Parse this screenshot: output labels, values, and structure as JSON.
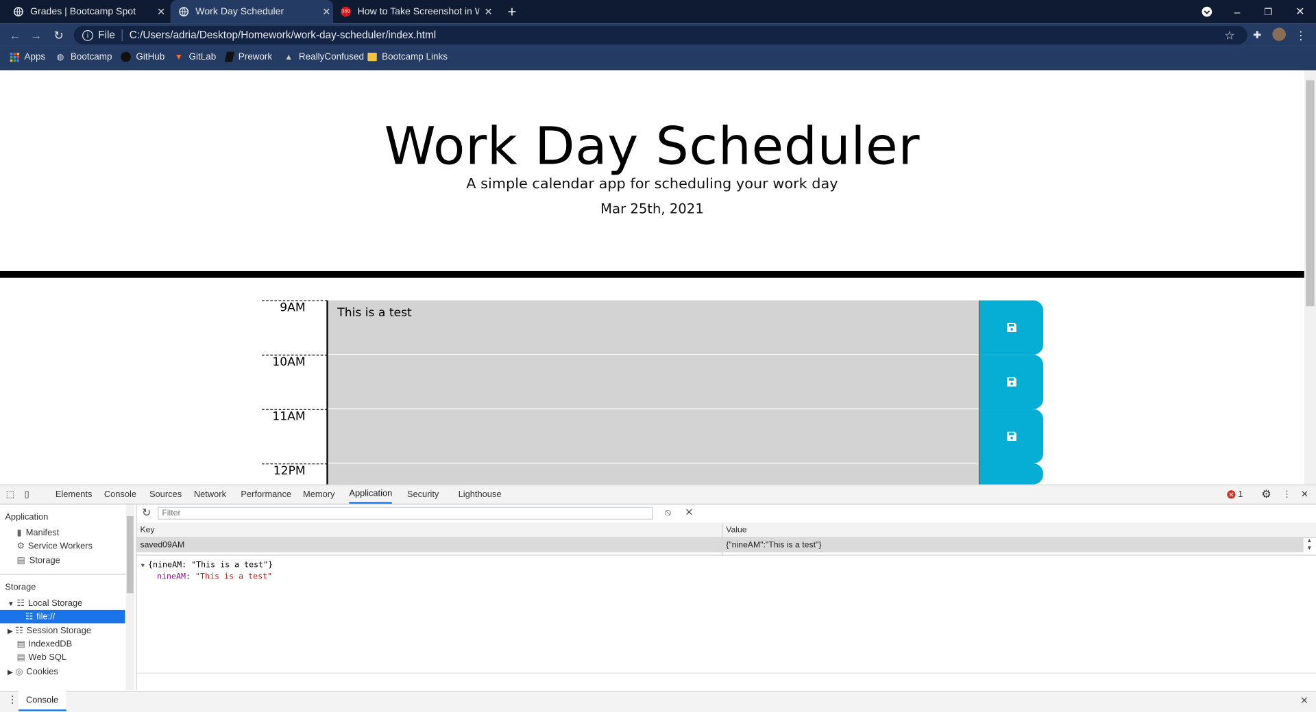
{
  "browser": {
    "tabs": [
      {
        "title": "Grades | Bootcamp Spot",
        "icon": "globe-icon"
      },
      {
        "title": "Work Day Scheduler",
        "icon": "globe-icon"
      },
      {
        "title": "How to Take Screenshot in Windows",
        "icon": "360-icon"
      }
    ],
    "url_scheme": "File",
    "url": "C:/Users/adria/Desktop/Homework/work-day-scheduler/index.html",
    "bookmarks": [
      {
        "label": "Apps",
        "icon": "apps-grid-icon"
      },
      {
        "label": "Bootcamp",
        "icon": "globe-icon"
      },
      {
        "label": "GitHub",
        "icon": "github-icon"
      },
      {
        "label": "GitLab",
        "icon": "gitlab-icon"
      },
      {
        "label": "Prework",
        "icon": "book-icon"
      },
      {
        "label": "ReallyConfused",
        "icon": "grad-cap-icon"
      },
      {
        "label": "Bootcamp Links",
        "icon": "folder-icon"
      }
    ]
  },
  "page": {
    "title": "Work Day Scheduler",
    "subtitle": "A simple calendar app for scheduling your work day",
    "date": "Mar 25th, 2021",
    "rows": [
      {
        "hour": "9AM",
        "text": "This is a test"
      },
      {
        "hour": "10AM",
        "text": ""
      },
      {
        "hour": "11AM",
        "text": ""
      },
      {
        "hour": "12PM",
        "text": ""
      }
    ]
  },
  "devtools": {
    "tabs": [
      "Elements",
      "Console",
      "Sources",
      "Network",
      "Performance",
      "Memory",
      "Application",
      "Security",
      "Lighthouse"
    ],
    "active_tab": "Application",
    "error_count": "1",
    "sidebar": {
      "application_header": "Application",
      "application_items": [
        "Manifest",
        "Service Workers",
        "Storage"
      ],
      "storage_header": "Storage",
      "storage_items": [
        "Local Storage",
        "file://",
        "Session Storage",
        "IndexedDB",
        "Web SQL",
        "Cookies"
      ]
    },
    "filter_placeholder": "Filter",
    "table": {
      "key_header": "Key",
      "value_header": "Value",
      "row_key": "saved09AM",
      "row_value": "{\"nineAM\":\"This is a test\"}"
    },
    "json_preview": {
      "line1": "{nineAM: \"This is a test\"}",
      "key": "nineAM",
      "value": "\"This is a test\""
    },
    "drawer_tab": "Console"
  },
  "colors": {
    "accent_blue": "#06aed5",
    "desc_gray": "#d3d3d3",
    "chrome_dark": "#0f1b33",
    "chrome_mid": "#243b64"
  }
}
